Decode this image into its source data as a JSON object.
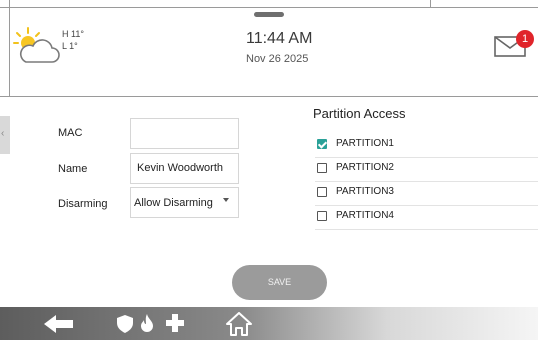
{
  "header": {
    "weather": {
      "icon": "partly-cloudy-icon",
      "high": "H 11°",
      "low": "L 1°"
    },
    "time": "11:44 AM",
    "date": "Nov 26 2025",
    "messages": {
      "icon": "envelope-icon",
      "count": "1"
    }
  },
  "form": {
    "mac": {
      "label": "MAC",
      "value": ""
    },
    "name": {
      "label": "Name",
      "value": "Kevin Woodworth"
    },
    "disarming": {
      "label": "Disarming",
      "value": "Allow Disarming"
    }
  },
  "partitions": {
    "title": "Partition Access",
    "items": [
      {
        "label": "PARTITION1",
        "checked": true
      },
      {
        "label": "PARTITION2",
        "checked": false
      },
      {
        "label": "PARTITION3",
        "checked": false
      },
      {
        "label": "PARTITION4",
        "checked": false
      }
    ]
  },
  "actions": {
    "save_label": "SAVE"
  },
  "bottom_nav": {
    "icons": [
      "back-arrow-icon",
      "shield-icon",
      "fire-icon",
      "medical-cross-icon",
      "home-icon"
    ]
  },
  "colors": {
    "accent": "#2aa198",
    "badge": "#e0242a",
    "save_button": "#9b9b9b"
  }
}
